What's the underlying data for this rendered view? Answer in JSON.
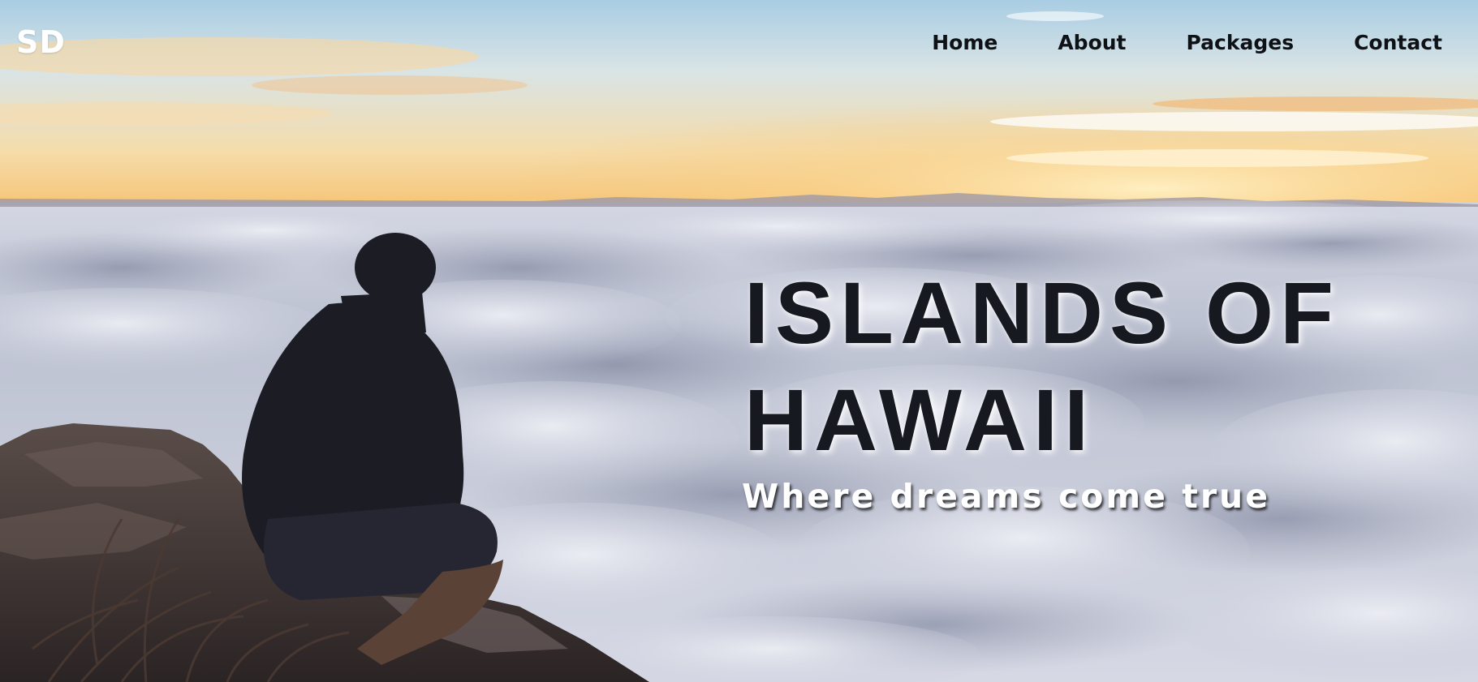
{
  "logo": {
    "text": "SD"
  },
  "nav": {
    "items": [
      {
        "label": "Home"
      },
      {
        "label": "About"
      },
      {
        "label": "Packages"
      },
      {
        "label": "Contact"
      }
    ]
  },
  "hero": {
    "title_line1": "ISLANDS OF",
    "title_line2": "HAWAII",
    "subtitle": "Where dreams come true"
  },
  "colors": {
    "nav_text": "#0e1116",
    "logo_text": "#ffffff",
    "headline": "#16191f",
    "tagline": "#ffffff",
    "sky_top": "#a9cde3",
    "sky_horizon": "#f6c67a",
    "clouds": "#b9bfd0",
    "silhouette": "#1c1c24"
  }
}
